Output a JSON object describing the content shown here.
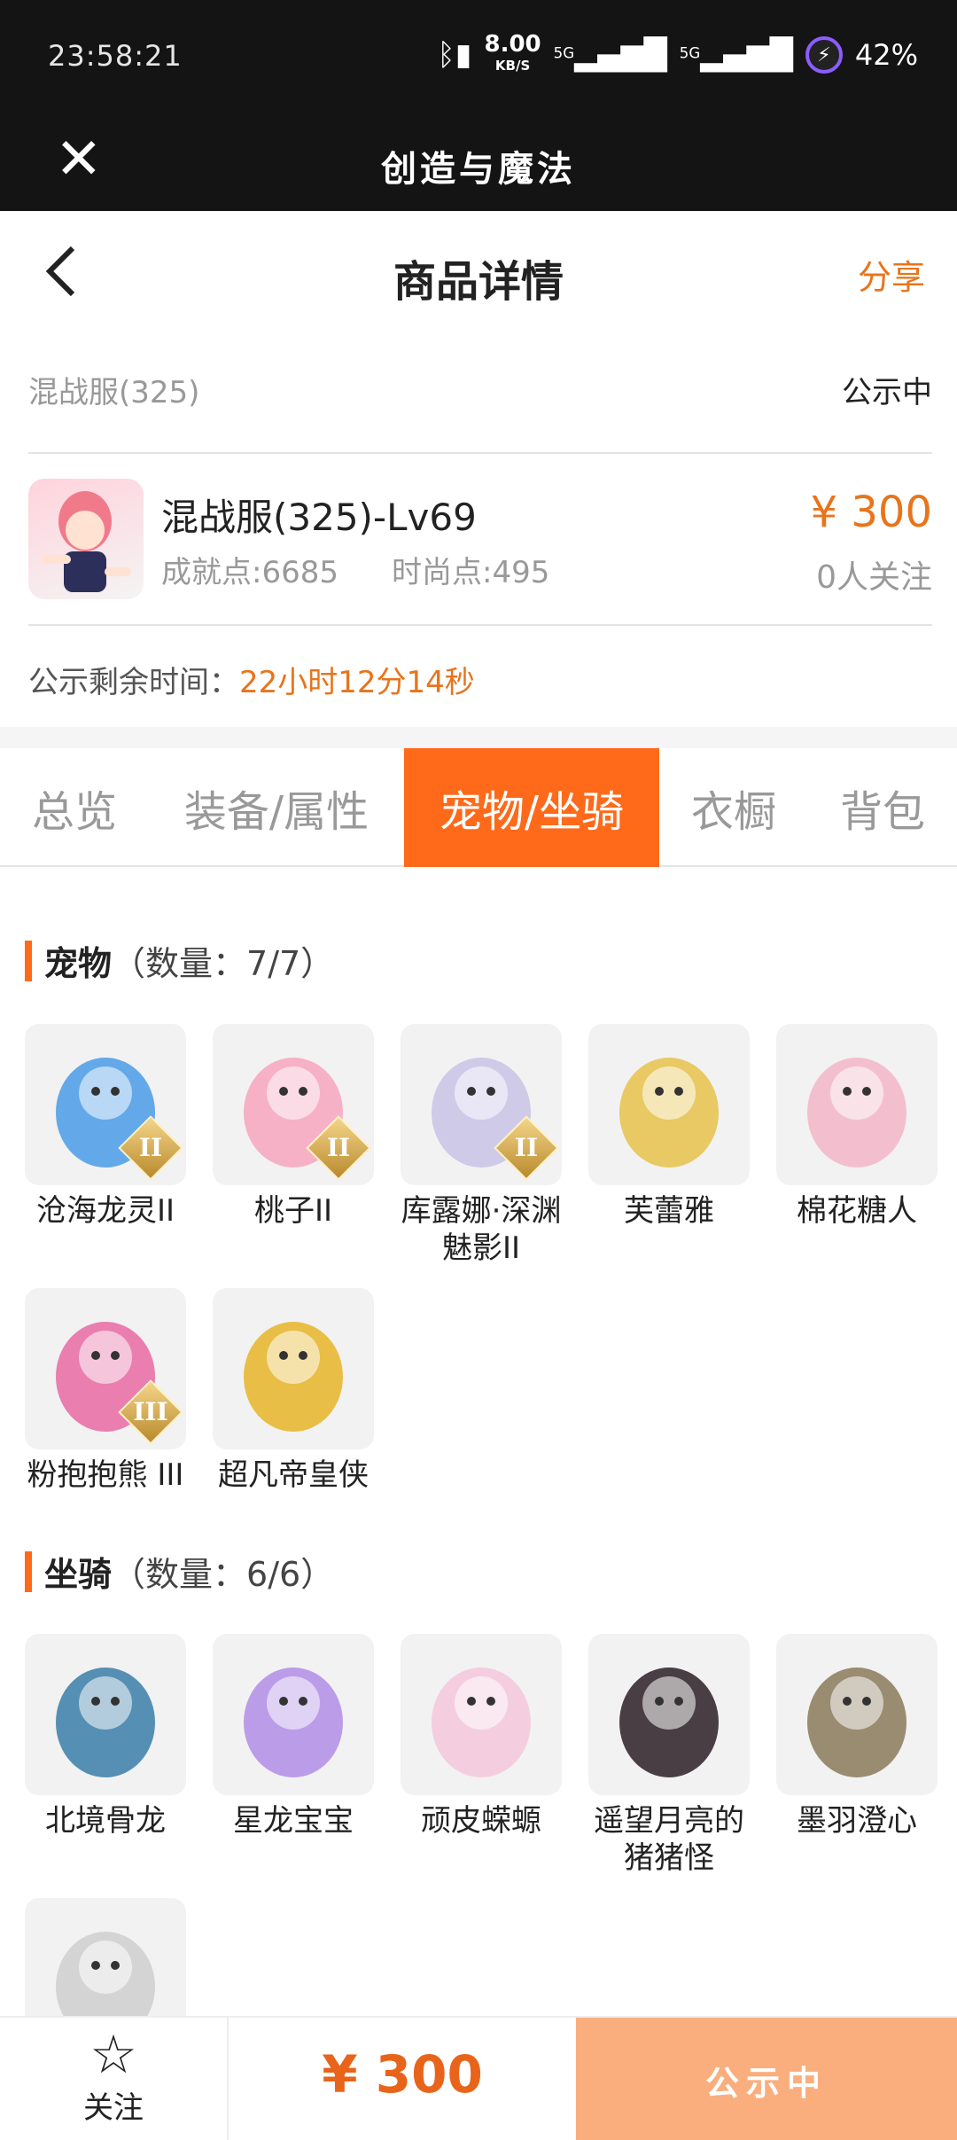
{
  "status_bar": {
    "time": "23:58:21",
    "net_speed": "8.00",
    "net_unit": "KB/S",
    "sig1": "5G",
    "sig2": "5G",
    "battery": "42%"
  },
  "app_bar": {
    "title": "创造与魔法"
  },
  "page_header": {
    "title": "商品详情",
    "share": "分享"
  },
  "listing": {
    "server": "混战服(325)",
    "status": "公示中",
    "character_name": "混战服(325)-Lv69",
    "achievement": "成就点:6685",
    "fashion": "时尚点:495",
    "price": "¥ 300",
    "followers": "0人关注",
    "remain_label": "公示剩余时间：",
    "remain_value": "22小时12分14秒"
  },
  "tabs": [
    {
      "label": "总览",
      "active": false
    },
    {
      "label": "装备/属性",
      "active": false
    },
    {
      "label": "宠物/坐骑",
      "active": true
    },
    {
      "label": "衣橱",
      "active": false
    },
    {
      "label": "背包",
      "active": false
    }
  ],
  "pets": {
    "title": "宠物",
    "count": "（数量：7/7）",
    "items": [
      {
        "name": "沧海龙灵II",
        "badge": "II",
        "icon": "blue-dragon-girl-icon",
        "color": "#4a9be8"
      },
      {
        "name": "桃子II",
        "badge": "II",
        "icon": "pink-bunny-icon",
        "color": "#f7a6bf"
      },
      {
        "name": "库露娜·深渊魅影II",
        "badge": "II",
        "icon": "white-haired-spirit-icon",
        "color": "#c9c3e6"
      },
      {
        "name": "芙蕾雅",
        "badge": "",
        "icon": "golden-crown-maiden-icon",
        "color": "#e8c24a"
      },
      {
        "name": "棉花糖人",
        "badge": "",
        "icon": "pink-cotton-candy-icon",
        "color": "#f3b6c9"
      },
      {
        "name": "粉抱抱熊 III",
        "badge": "III",
        "icon": "pink-bear-icon",
        "color": "#e86aa3"
      },
      {
        "name": "超凡帝皇侠",
        "badge": "",
        "icon": "golden-armor-hero-icon",
        "color": "#e8b528"
      }
    ]
  },
  "mounts": {
    "title": "坐骑",
    "count": "（数量：6/6）",
    "items": [
      {
        "name": "北境骨龙",
        "icon": "bone-dragon-icon",
        "color": "#3a7ea8"
      },
      {
        "name": "星龙宝宝",
        "icon": "star-dragon-baby-icon",
        "color": "#b18de8"
      },
      {
        "name": "顽皮蝾螈",
        "icon": "axolotl-icon",
        "color": "#f4c8da"
      },
      {
        "name": "遥望月亮的猪猪怪",
        "icon": "black-pig-icon",
        "color": "#2b1f26"
      },
      {
        "name": "墨羽澄心",
        "icon": "feather-staff-icon",
        "color": "#8a7a5a"
      },
      {
        "name": "",
        "icon": "silver-mech-icon",
        "color": "#cfcfcf"
      }
    ]
  },
  "bottom_bar": {
    "follow_label": "关注",
    "price": "¥ 300",
    "action_label": "公示中"
  }
}
